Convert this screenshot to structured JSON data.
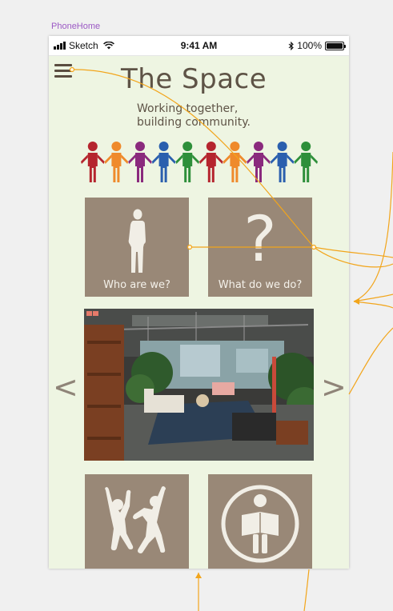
{
  "artboard": {
    "label": "PhoneHome"
  },
  "status_bar": {
    "carrier": "Sketch",
    "time": "9:41 AM",
    "battery": "100%"
  },
  "header": {
    "title": "The Space",
    "tagline_line1": "Working together,",
    "tagline_line2": "building community."
  },
  "people_colors": [
    "#b5252e",
    "#ef8a2b",
    "#8a2a7d",
    "#2a5fae",
    "#2e8f3a",
    "#b5252e",
    "#ef8a2b",
    "#8a2a7d",
    "#2a5fae",
    "#2e8f3a"
  ],
  "tiles": {
    "who": {
      "label": "Who are we?",
      "icon": "person-standing-icon"
    },
    "what": {
      "label": "What do we do?",
      "glyph": "?",
      "icon": "question-mark-icon"
    },
    "events": {
      "icon": "dancing-people-icon"
    },
    "learn": {
      "icon": "reading-person-icon"
    }
  },
  "carousel": {
    "prev_label": "<",
    "next_label": ">",
    "image_subject": "coworking-lounge-photo"
  },
  "colors": {
    "background": "#eef5e2",
    "tile": "#998877",
    "title_text": "#5e5346",
    "prototype_link": "#f2a51b"
  }
}
